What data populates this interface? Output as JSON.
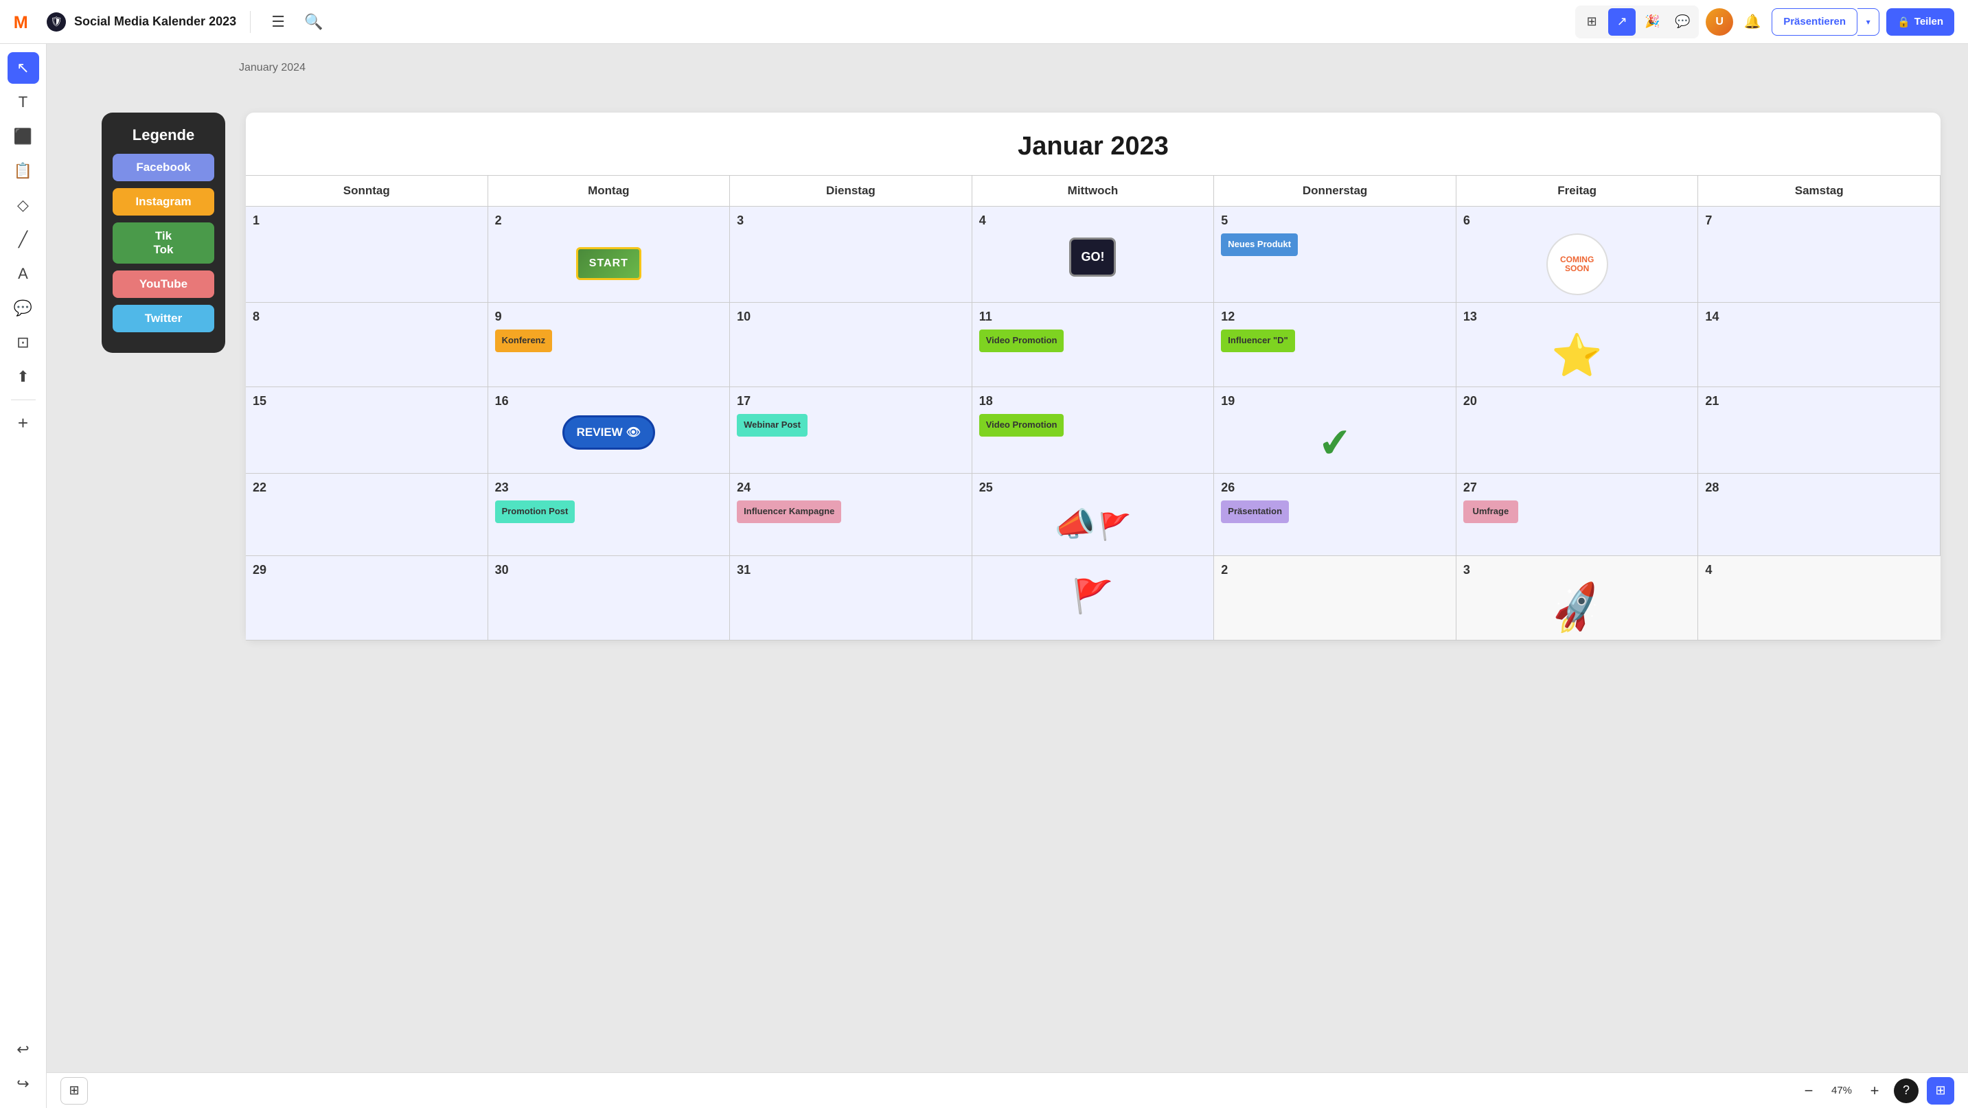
{
  "topbar": {
    "logo_alt": "Miro",
    "board_title": "Social Media Kalender 2023",
    "menu_icon": "☰",
    "search_icon": "🔍",
    "present_label": "Präsentieren",
    "share_label": "Teilen",
    "share_icon": "🔒"
  },
  "sidebar_tools": [
    {
      "name": "cursor-tool",
      "icon": "↖",
      "active": true
    },
    {
      "name": "text-tool",
      "icon": "T",
      "active": false
    },
    {
      "name": "table-tool",
      "icon": "⊞",
      "active": false
    },
    {
      "name": "sticky-tool",
      "icon": "⬜",
      "active": false
    },
    {
      "name": "shape-tool",
      "icon": "◇",
      "active": false
    },
    {
      "name": "pen-tool",
      "icon": "✏",
      "active": false
    },
    {
      "name": "text2-tool",
      "icon": "A",
      "active": false
    },
    {
      "name": "comment-tool",
      "icon": "💬",
      "active": false
    },
    {
      "name": "frame-tool",
      "icon": "⬜",
      "active": false
    },
    {
      "name": "upload-tool",
      "icon": "⬆",
      "active": false
    }
  ],
  "legend": {
    "title": "Legende",
    "items": [
      {
        "label": "Facebook",
        "color": "#7c8fe8"
      },
      {
        "label": "Instagram",
        "color": "#f5a623"
      },
      {
        "label": "Tik\nTok",
        "color": "#4a9a4a"
      },
      {
        "label": "YouTube",
        "color": "#e87878"
      },
      {
        "label": "Twitter",
        "color": "#50b8e8"
      }
    ]
  },
  "calendar": {
    "title": "Januar 2023",
    "month_label": "January 2024",
    "headers": [
      "Sonntag",
      "Montag",
      "Dienstag",
      "Mittwoch",
      "Donnerstag",
      "Freitag",
      "Samstag"
    ],
    "rows": [
      [
        {
          "day": "1",
          "outside": false,
          "content": ""
        },
        {
          "day": "2",
          "outside": false,
          "content": "start"
        },
        {
          "day": "3",
          "outside": false,
          "content": ""
        },
        {
          "day": "4",
          "outside": false,
          "content": "go"
        },
        {
          "day": "5",
          "outside": false,
          "content": "neues_produkt"
        },
        {
          "day": "6",
          "outside": false,
          "content": "coming_soon"
        },
        {
          "day": "7",
          "outside": false,
          "content": ""
        }
      ],
      [
        {
          "day": "8",
          "outside": false,
          "content": ""
        },
        {
          "day": "9",
          "outside": false,
          "content": "konferenz"
        },
        {
          "day": "10",
          "outside": false,
          "content": ""
        },
        {
          "day": "11",
          "outside": false,
          "content": "video_promo"
        },
        {
          "day": "12",
          "outside": false,
          "content": "influencer_d"
        },
        {
          "day": "13",
          "outside": false,
          "content": "star"
        },
        {
          "day": "14",
          "outside": false,
          "content": ""
        }
      ],
      [
        {
          "day": "15",
          "outside": false,
          "content": ""
        },
        {
          "day": "16",
          "outside": false,
          "content": "review"
        },
        {
          "day": "17",
          "outside": false,
          "content": "webinar_post"
        },
        {
          "day": "18",
          "outside": false,
          "content": "video_promo2"
        },
        {
          "day": "19",
          "outside": false,
          "content": "check"
        },
        {
          "day": "20",
          "outside": false,
          "content": ""
        },
        {
          "day": "21",
          "outside": false,
          "content": ""
        }
      ],
      [
        {
          "day": "22",
          "outside": false,
          "content": ""
        },
        {
          "day": "23",
          "outside": false,
          "content": "promotion_post"
        },
        {
          "day": "24",
          "outside": false,
          "content": "influencer_kampagne"
        },
        {
          "day": "25",
          "outside": false,
          "content": "megaphone"
        },
        {
          "day": "26",
          "outside": false,
          "content": "praesentation"
        },
        {
          "day": "27",
          "outside": false,
          "content": "umfrage"
        },
        {
          "day": "28",
          "outside": false,
          "content": ""
        }
      ],
      [
        {
          "day": "29",
          "outside": false,
          "content": ""
        },
        {
          "day": "30",
          "outside": false,
          "content": ""
        },
        {
          "day": "31",
          "outside": false,
          "content": ""
        },
        {
          "day": "flag",
          "outside": false,
          "content": "flag"
        },
        {
          "day": "2",
          "outside": true,
          "content": ""
        },
        {
          "day": "3",
          "outside": true,
          "content": "rocket"
        },
        {
          "day": "4",
          "outside": true,
          "content": ""
        }
      ]
    ],
    "notes": {
      "start": "START",
      "go": "GO!",
      "neues_produkt": "Neues Produkt",
      "coming_soon": "COMING SOON",
      "konferenz": "Konferenz",
      "video_promo": "Video Promotion",
      "influencer_d": "Influencer \"D\"",
      "webinar_post": "Webinar Post",
      "video_promo2": "Video Promotion",
      "review": "REVIEW",
      "promotion_post": "Promotion Post",
      "influencer_kampagne": "Influencer Kampagne",
      "praesentation": "Präsentation",
      "umfrage": "Umfrage"
    }
  },
  "bottombar": {
    "zoom_minus": "−",
    "zoom_level": "47%",
    "zoom_plus": "+",
    "help_icon": "?",
    "panel_icon": "⊞"
  }
}
